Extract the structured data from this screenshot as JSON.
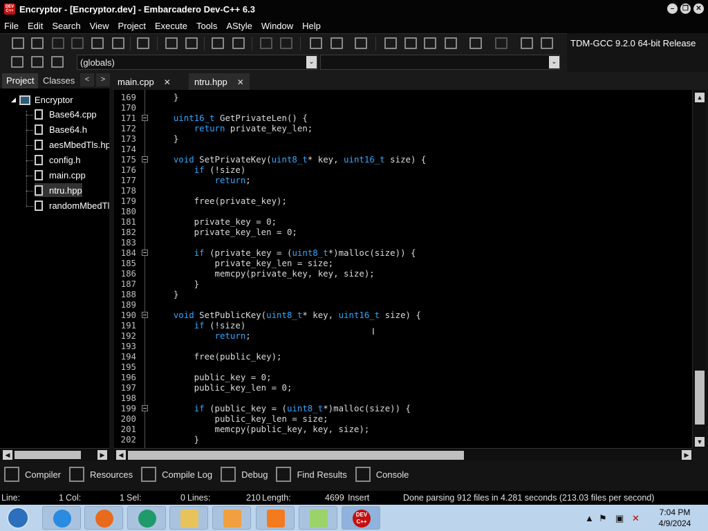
{
  "window": {
    "title": "Encryptor - [Encryptor.dev] - Embarcadero Dev-C++ 6.3",
    "app_icon_text": "DEV C++",
    "minimize": "–",
    "restore": "❐",
    "close": "✕"
  },
  "menu": [
    "File",
    "Edit",
    "Search",
    "View",
    "Project",
    "Execute",
    "Tools",
    "AStyle",
    "Window",
    "Help"
  ],
  "toolbar": {
    "compiler": "TDM-GCC 9.2.0 64-bit Release",
    "scope": "(globals)",
    "dropdown_arrow": "⌄"
  },
  "left_panel": {
    "tabs": [
      "Project",
      "Classes"
    ],
    "nav_prev": "<",
    "nav_next": ">",
    "root": "Encryptor",
    "files": [
      "Base64.cpp",
      "Base64.h",
      "aesMbedTls.hpp",
      "config.h",
      "main.cpp",
      "ntru.hpp",
      "randomMbedTls.hpp"
    ],
    "selected_file_index": 5
  },
  "editor_tabs": [
    {
      "label": "main.cpp",
      "close": "✕"
    },
    {
      "label": "ntru.hpp",
      "close": "✕"
    }
  ],
  "active_editor_tab_index": 1,
  "code": [
    {
      "n": "169",
      "fold": false,
      "text": "    }"
    },
    {
      "n": "170",
      "fold": false,
      "text": ""
    },
    {
      "n": "171",
      "fold": true,
      "text": "    uint16_t GetPrivateLen() {"
    },
    {
      "n": "172",
      "fold": false,
      "text": "        return private_key_len;"
    },
    {
      "n": "173",
      "fold": false,
      "text": "    }"
    },
    {
      "n": "174",
      "fold": false,
      "text": ""
    },
    {
      "n": "175",
      "fold": true,
      "text": "    void SetPrivateKey(uint8_t* key, uint16_t size) {"
    },
    {
      "n": "176",
      "fold": false,
      "text": "        if (!size)"
    },
    {
      "n": "177",
      "fold": false,
      "text": "            return;"
    },
    {
      "n": "178",
      "fold": false,
      "text": ""
    },
    {
      "n": "179",
      "fold": false,
      "text": "        free(private_key);"
    },
    {
      "n": "180",
      "fold": false,
      "text": ""
    },
    {
      "n": "181",
      "fold": false,
      "text": "        private_key = 0;"
    },
    {
      "n": "182",
      "fold": false,
      "text": "        private_key_len = 0;"
    },
    {
      "n": "183",
      "fold": false,
      "text": ""
    },
    {
      "n": "184",
      "fold": true,
      "text": "        if (private_key = (uint8_t*)malloc(size)) {"
    },
    {
      "n": "185",
      "fold": false,
      "text": "            private_key_len = size;"
    },
    {
      "n": "186",
      "fold": false,
      "text": "            memcpy(private_key, key, size);"
    },
    {
      "n": "187",
      "fold": false,
      "text": "        }"
    },
    {
      "n": "188",
      "fold": false,
      "text": "    }"
    },
    {
      "n": "189",
      "fold": false,
      "text": ""
    },
    {
      "n": "190",
      "fold": true,
      "text": "    void SetPublicKey(uint8_t* key, uint16_t size) {"
    },
    {
      "n": "191",
      "fold": false,
      "text": "        if (!size)"
    },
    {
      "n": "192",
      "fold": false,
      "text": "            return;"
    },
    {
      "n": "193",
      "fold": false,
      "text": ""
    },
    {
      "n": "194",
      "fold": false,
      "text": "        free(public_key);"
    },
    {
      "n": "195",
      "fold": false,
      "text": ""
    },
    {
      "n": "196",
      "fold": false,
      "text": "        public_key = 0;"
    },
    {
      "n": "197",
      "fold": false,
      "text": "        public_key_len = 0;"
    },
    {
      "n": "198",
      "fold": false,
      "text": ""
    },
    {
      "n": "199",
      "fold": true,
      "text": "        if (public_key = (uint8_t*)malloc(size)) {"
    },
    {
      "n": "200",
      "fold": false,
      "text": "            public_key_len = size;"
    },
    {
      "n": "201",
      "fold": false,
      "text": "            memcpy(public_key, key, size);"
    },
    {
      "n": "202",
      "fold": false,
      "text": "        }"
    }
  ],
  "bottom_tabs": [
    {
      "label": "Compiler",
      "icon": "grid-icon"
    },
    {
      "label": "Resources",
      "icon": "resources-icon"
    },
    {
      "label": "Compile Log",
      "icon": "chart-icon"
    },
    {
      "label": "Debug",
      "icon": "check-icon"
    },
    {
      "label": "Find Results",
      "icon": "find-icon"
    },
    {
      "label": "Console",
      "icon": "console-icon"
    }
  ],
  "status": {
    "line": "Line:",
    "line_val": "1",
    "col": "Col:",
    "col_val": "1",
    "sel": "Sel:",
    "sel_val": "0",
    "lines": "Lines:",
    "lines_val": "210",
    "length": "Length:",
    "length_val": "4699",
    "mode": "Insert",
    "message": "Done parsing 912 files in 4.281 seconds (213.03 files per second)"
  },
  "taskbar": {
    "time": "7:04 PM",
    "date": "4/9/2024",
    "apps": [
      "internet-explorer",
      "firefox",
      "app-green",
      "file-explorer",
      "media-player",
      "xampp",
      "notepad",
      "dev-cpp"
    ],
    "devcpp_label": "DEV C++"
  },
  "colors": {
    "keyword": "#2fa8ff",
    "background": "#000000",
    "chrome": "#1a1a1a",
    "taskbar": "#bcd4ec"
  }
}
